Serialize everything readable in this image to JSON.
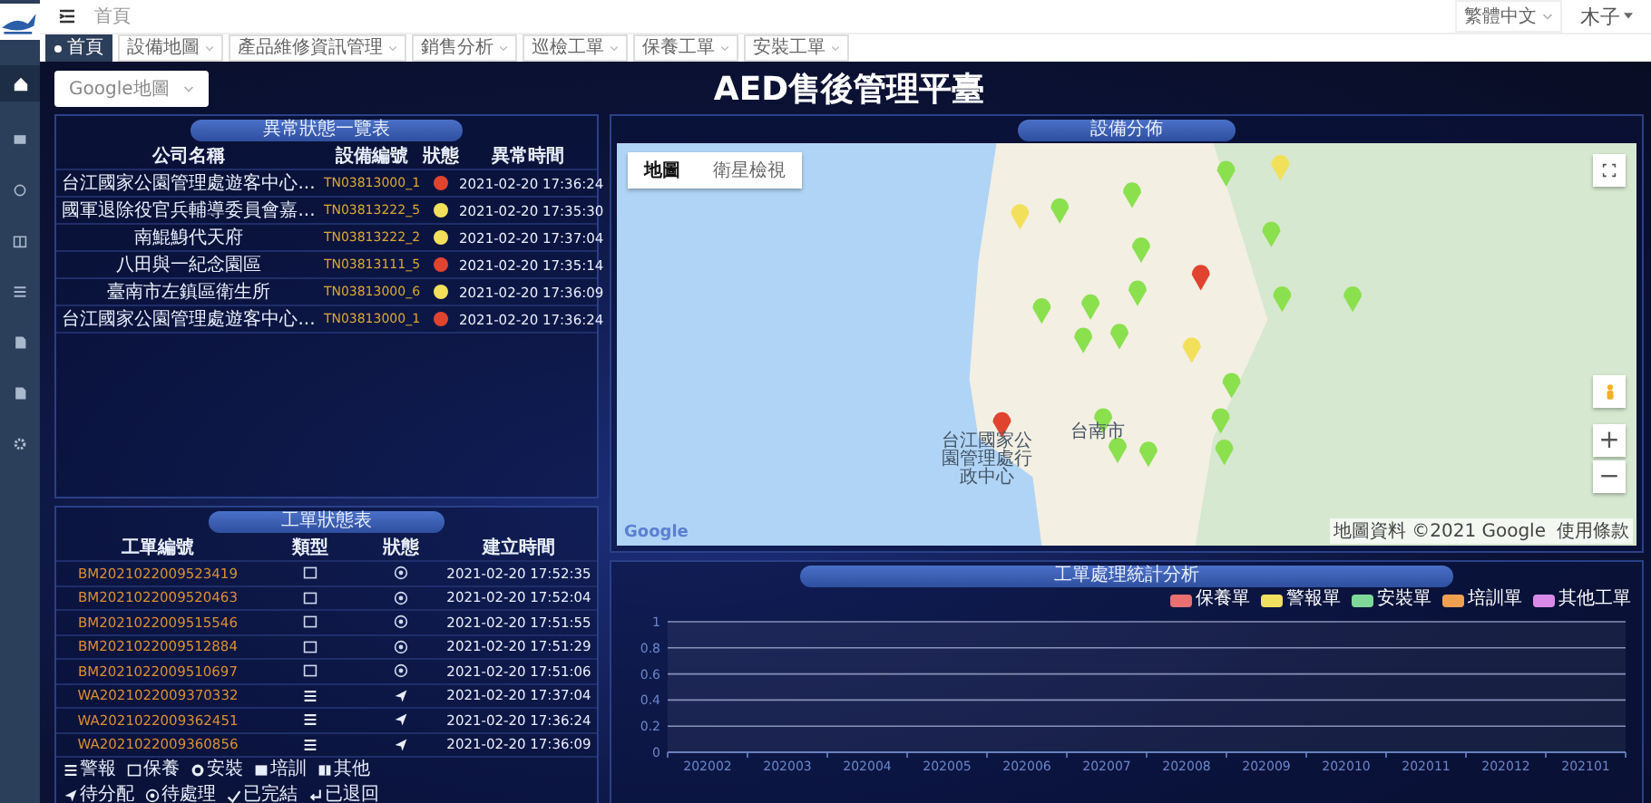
{
  "header": {
    "breadcrumb": "首頁",
    "language": "繁體中文",
    "user": "木子"
  },
  "tabs": [
    {
      "label": "首頁",
      "selected": true
    },
    {
      "label": "設備地圖",
      "selected": false
    },
    {
      "label": "產品維修資訊管理",
      "selected": false
    },
    {
      "label": "銷售分析",
      "selected": false
    },
    {
      "label": "巡檢工單",
      "selected": false
    },
    {
      "label": "保養工單",
      "selected": false
    },
    {
      "label": "安裝工單",
      "selected": false
    }
  ],
  "map_selector": {
    "value": "Google地圖"
  },
  "title": "AED售後管理平臺",
  "alarm_table": {
    "title": "異常狀態一覽表",
    "columns": [
      "公司名稱",
      "設備編號",
      "狀態",
      "異常時間"
    ],
    "rows": [
      {
        "company": "台江國家公園管理處遊客中心...",
        "device": "TN03813000_1",
        "color": "#e0442f",
        "time": "2021-02-20 17:36:24"
      },
      {
        "company": "國軍退除役官兵輔導委員會嘉...",
        "device": "TN03813222_5",
        "color": "#f2e05a",
        "time": "2021-02-20 17:35:30"
      },
      {
        "company": "南鯤鯓代天府",
        "device": "TN03813222_2",
        "color": "#f2e05a",
        "time": "2021-02-20 17:37:04"
      },
      {
        "company": "八田與一紀念園區",
        "device": "TN03813111_5",
        "color": "#e0442f",
        "time": "2021-02-20 17:35:14"
      },
      {
        "company": "臺南市左鎮區衛生所",
        "device": "TN03813000_6",
        "color": "#f2e05a",
        "time": "2021-02-20 17:36:09"
      },
      {
        "company": "台江國家公園管理處遊客中心...",
        "device": "TN03813000_1",
        "color": "#e0442f",
        "time": "2021-02-20 17:36:24"
      }
    ]
  },
  "work_orders": {
    "title": "工單狀態表",
    "columns": [
      "工單編號",
      "類型",
      "狀態",
      "建立時間"
    ],
    "rows": [
      {
        "order": "BM2021022009523419",
        "type": {
          "kind": "maintenance"
        },
        "status": {
          "kind": "pending"
        },
        "time": "2021-02-20 17:52:35"
      },
      {
        "order": "BM2021022009520463",
        "type": {
          "kind": "maintenance"
        },
        "status": {
          "kind": "pending"
        },
        "time": "2021-02-20 17:52:04"
      },
      {
        "order": "BM2021022009515546",
        "type": {
          "kind": "maintenance"
        },
        "status": {
          "kind": "pending"
        },
        "time": "2021-02-20 17:51:55"
      },
      {
        "order": "BM2021022009512884",
        "type": {
          "kind": "maintenance"
        },
        "status": {
          "kind": "pending"
        },
        "time": "2021-02-20 17:51:29"
      },
      {
        "order": "BM2021022009510697",
        "type": {
          "kind": "maintenance"
        },
        "status": {
          "kind": "pending"
        },
        "time": "2021-02-20 17:51:06"
      },
      {
        "order": "WA2021022009370332",
        "type": {
          "kind": "alarm"
        },
        "status": {
          "kind": "assign"
        },
        "time": "2021-02-20 17:37:04"
      },
      {
        "order": "WA2021022009362451",
        "type": {
          "kind": "alarm"
        },
        "status": {
          "kind": "assign"
        },
        "time": "2021-02-20 17:36:24"
      },
      {
        "order": "WA2021022009360856",
        "type": {
          "kind": "alarm"
        },
        "status": {
          "kind": "assign"
        },
        "time": "2021-02-20 17:36:09"
      }
    ],
    "legend_types": [
      {
        "kind": "alarm",
        "label": "警報"
      },
      {
        "kind": "maintenance",
        "label": "保養"
      },
      {
        "kind": "install",
        "label": "安裝"
      },
      {
        "kind": "training",
        "label": "培訓"
      },
      {
        "kind": "other",
        "label": "其他"
      }
    ],
    "legend_status": [
      {
        "kind": "assign",
        "label": "待分配"
      },
      {
        "kind": "pending",
        "label": "待處理"
      },
      {
        "kind": "done",
        "label": "已完結"
      },
      {
        "kind": "returned",
        "label": "已退回"
      }
    ]
  },
  "device_map": {
    "title": "設備分佈",
    "map_types": [
      {
        "label": "地圖",
        "selected": true
      },
      {
        "label": "衛星檢視",
        "selected": false
      }
    ],
    "place_labels": [
      "台江國家公園管理處行政中心",
      "台南市"
    ],
    "logo": "Google",
    "attribution": "地圖資料 ©2021 Google",
    "terms": "使用條款",
    "zoom_in": "+",
    "zoom_out": "−"
  },
  "stats": {
    "title": "工單處理統計分析",
    "chart_data": {
      "type": "bar",
      "categories": [
        "202002",
        "202003",
        "202004",
        "202005",
        "202006",
        "202007",
        "202008",
        "202009",
        "202010",
        "202011",
        "202012",
        "202101"
      ],
      "series": [
        {
          "name": "保養單",
          "color": "#e87070",
          "values": [
            null,
            null,
            null,
            null,
            null,
            null,
            null,
            null,
            null,
            null,
            null,
            null
          ]
        },
        {
          "name": "警報單",
          "color": "#f0e060",
          "values": [
            null,
            null,
            null,
            null,
            null,
            null,
            null,
            null,
            null,
            null,
            null,
            null
          ]
        },
        {
          "name": "安裝單",
          "color": "#7ed89a",
          "values": [
            null,
            null,
            null,
            null,
            null,
            null,
            null,
            null,
            null,
            null,
            null,
            null
          ]
        },
        {
          "name": "培訓單",
          "color": "#f0a050",
          "values": [
            null,
            null,
            null,
            null,
            null,
            null,
            null,
            null,
            null,
            null,
            null,
            null
          ]
        },
        {
          "name": "其他工單",
          "color": "#d98ae8",
          "values": [
            null,
            null,
            null,
            null,
            null,
            null,
            null,
            null,
            null,
            null,
            null,
            null
          ]
        }
      ],
      "grid": true,
      "ylim": [
        0,
        1
      ],
      "yticks": [
        0,
        0.2,
        0.4,
        0.6,
        0.8,
        1
      ]
    }
  }
}
